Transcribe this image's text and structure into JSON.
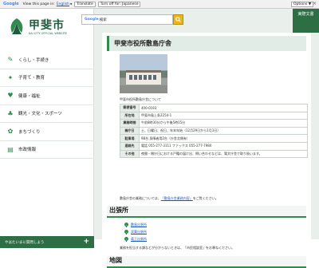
{
  "translate_bar": {
    "logo": "Google",
    "view_text": "View this page in:",
    "language": "English",
    "translate_button": "Translate",
    "turn_off_text": "Turn off for: Japanese",
    "options_button": "Options ▼",
    "close": "×"
  },
  "site": {
    "name": "甲斐市",
    "name_en": "KAI CITY OFFICIAL WEBSITE"
  },
  "search": {
    "google_label": "Google",
    "placeholder": "検索"
  },
  "top_button": "実際文書",
  "nav": [
    {
      "icon": "person-icon",
      "label": "くらし・手続き"
    },
    {
      "icon": "child-icon",
      "label": "子育て・教育"
    },
    {
      "icon": "heart-icon",
      "label": "健康・福祉"
    },
    {
      "icon": "tree-icon",
      "label": "観光・文化・スポーツ"
    },
    {
      "icon": "gear-icon",
      "label": "まちづくり"
    },
    {
      "icon": "book-icon",
      "label": "市政情報"
    }
  ],
  "side_footer": "やはたいまに質問しよう",
  "page": {
    "title": "甲斐市役所敷島庁舎",
    "caption": "甲斐市役所敷島庁舎について",
    "info": [
      {
        "k": "郵便番号",
        "v": "400-0193"
      },
      {
        "k": "所在地",
        "v": "甲斐市島上条2254-1"
      },
      {
        "k": "業務時間",
        "v": "午前8時30分から午後5時15分"
      },
      {
        "k": "開庁日",
        "v": "土、日曜日、祝日、年末年始（12月29日から1月3日）"
      },
      {
        "k": "駐車場",
        "v": "98台 身障者用2台（庁舎北側有）"
      },
      {
        "k": "連絡先",
        "v": "電話 055-277-3111 ファックス 055-277-7980"
      },
      {
        "k": "その他",
        "v": "夜間・閉庁日における戸籍の届け出、問い合わせなどは、電文庁舎で取り扱います。"
      }
    ],
    "note_prefix": "敷島庁舎の業務については、",
    "note_link": "「敷島庁舎業務内容」",
    "note_suffix": "をご覧ください。",
    "section_branch": "出張所",
    "branch_links": [
      "敷島出張所",
      "双葉出張所",
      "竜王出張所"
    ],
    "branch_note": "業務を担当する課などが分からないときは、「市民相談室」をお尋ねください。",
    "section_map": "地図"
  }
}
